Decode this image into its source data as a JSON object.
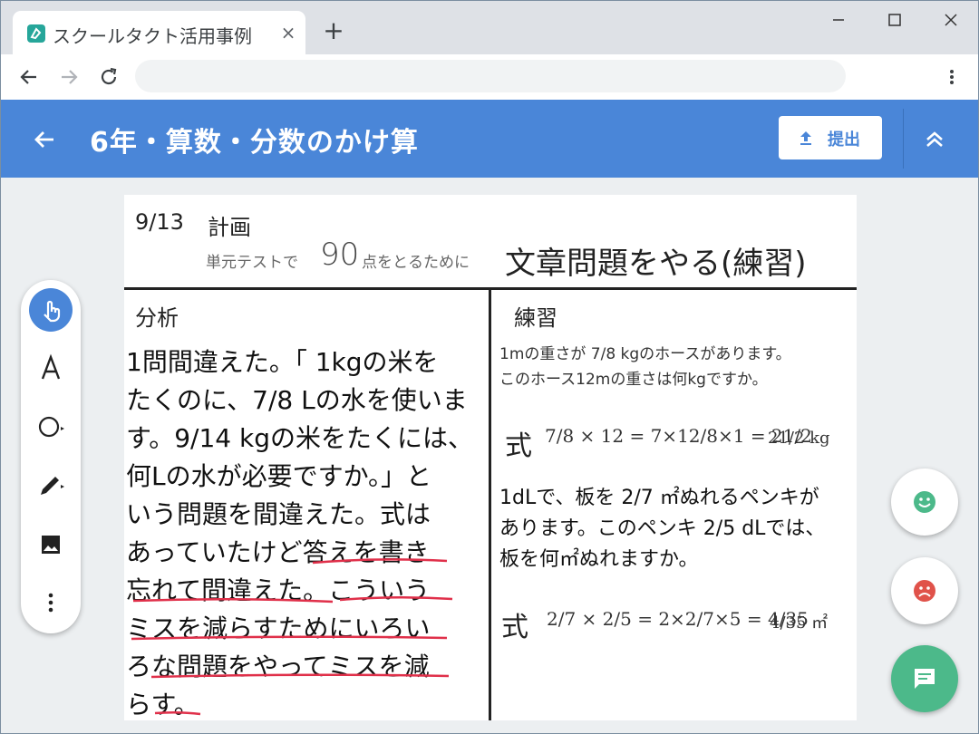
{
  "browser": {
    "tab_title": "スクールタクト活用事例",
    "tab_close": "×",
    "new_tab": "+"
  },
  "appbar": {
    "title": "6年・算数・分数のかけ算",
    "submit_label": "提出"
  },
  "sheet": {
    "date": "9/13",
    "plan_label": "計画",
    "goal_prefix": "単元テストで",
    "goal_score": "90",
    "goal_suffix": "点をとるために",
    "goal_main": "文章問題をやる(練習)",
    "left_heading": "分析",
    "right_heading": "練習",
    "analysis_lines": [
      "1問間違えた。「 1kgの米を",
      "たくのに、7/8 Lの水を使いま",
      "す。9/14 kgの米をたくには、",
      "何Lの水が必要ですか。」と",
      "いう問題を間違えた。式は",
      "あっていたけど答えを書き",
      "忘れて間違えた。こういう",
      "ミスを減らすためにいろい",
      "ろな問題をやってミスを減",
      "らす。"
    ],
    "problem1_line1": "1mの重さが 7/8 kgのホースがあります。",
    "problem1_line2": "このホース12mの重さは何kgですか。",
    "formula_label": "式",
    "formula1": "7/8 × 12 = 7×12/8×1 = 21/2",
    "answer1": "21/2 kg",
    "problem2_line1": "1dLで、板を 2/7 ㎡ぬれるペンキが",
    "problem2_line2": "あります。このペンキ 2/5 dLでは、",
    "problem2_line3": "板を何㎡ぬれますか。",
    "formula2": "2/7 × 2/5 = 2×2/7×5 = 4/35",
    "answer2": "4/35 ㎡"
  },
  "tools": [
    "pointer-tool",
    "text-tool",
    "shape-tool",
    "pen-tool",
    "image-tool",
    "more-tool"
  ],
  "colors": {
    "appbar": "#4a86d8",
    "good": "#4cb98a",
    "bad": "#e0524a",
    "underline": "#e0304a"
  }
}
